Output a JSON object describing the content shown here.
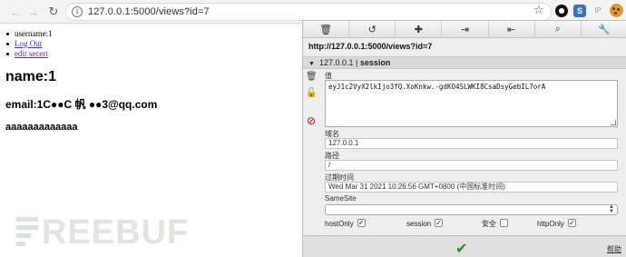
{
  "browser": {
    "url": "127.0.0.1:5000/views?id=7",
    "back_icon": "←",
    "forward_icon": "→",
    "reload_icon": "↻",
    "star_icon": "☆",
    "ext_s_label": "S",
    "ext_ip_label": "IP"
  },
  "page": {
    "menu": {
      "username": "username:1",
      "logout": "Log Out",
      "edit_secret": "edit secert"
    },
    "name_heading": "name:1",
    "email_heading": "email:1C●●C 帆 ●●3@qq.com",
    "text_line": "aaaaaaaaaaaaa",
    "watermark": "REEBUF"
  },
  "editor": {
    "toolbar": {
      "delete_icon": "🗑",
      "undo_icon": "↺",
      "add_icon": "✚",
      "import_icon": "⇥",
      "export_icon": "⇤",
      "search_icon": "⌕",
      "settings_icon": "🔧"
    },
    "address": "http://127.0.0.1:5000/views?id=7",
    "section": {
      "domain": "127.0.0.1",
      "separator": "|",
      "name": "session"
    },
    "value_label": "值",
    "value": "eyJ1c2VyX2lkIjo3fQ.XoKnkw.-gdKO4SLWKI8CsaDsyGebIL7orA",
    "domain_label": "域名",
    "domain_value": "127.0.0.1",
    "path_label": "路径",
    "path_value": "/",
    "expiry_label": "过期时间",
    "expiry_value": "Wed Mar 31 2021 10:26:56 GMT+0800 (中国标准时间)",
    "samesite_label": "SameSite",
    "samesite_value": "",
    "flags": {
      "hostonly_label": "hostOnly",
      "hostonly_checked": "✓",
      "session_label": "session",
      "session_checked": "✓",
      "secure_label": "安全",
      "secure_checked": "",
      "httponly_label": "httpOnly",
      "httponly_checked": "✓"
    },
    "ok_icon": "✔",
    "help_label": "帮助"
  }
}
